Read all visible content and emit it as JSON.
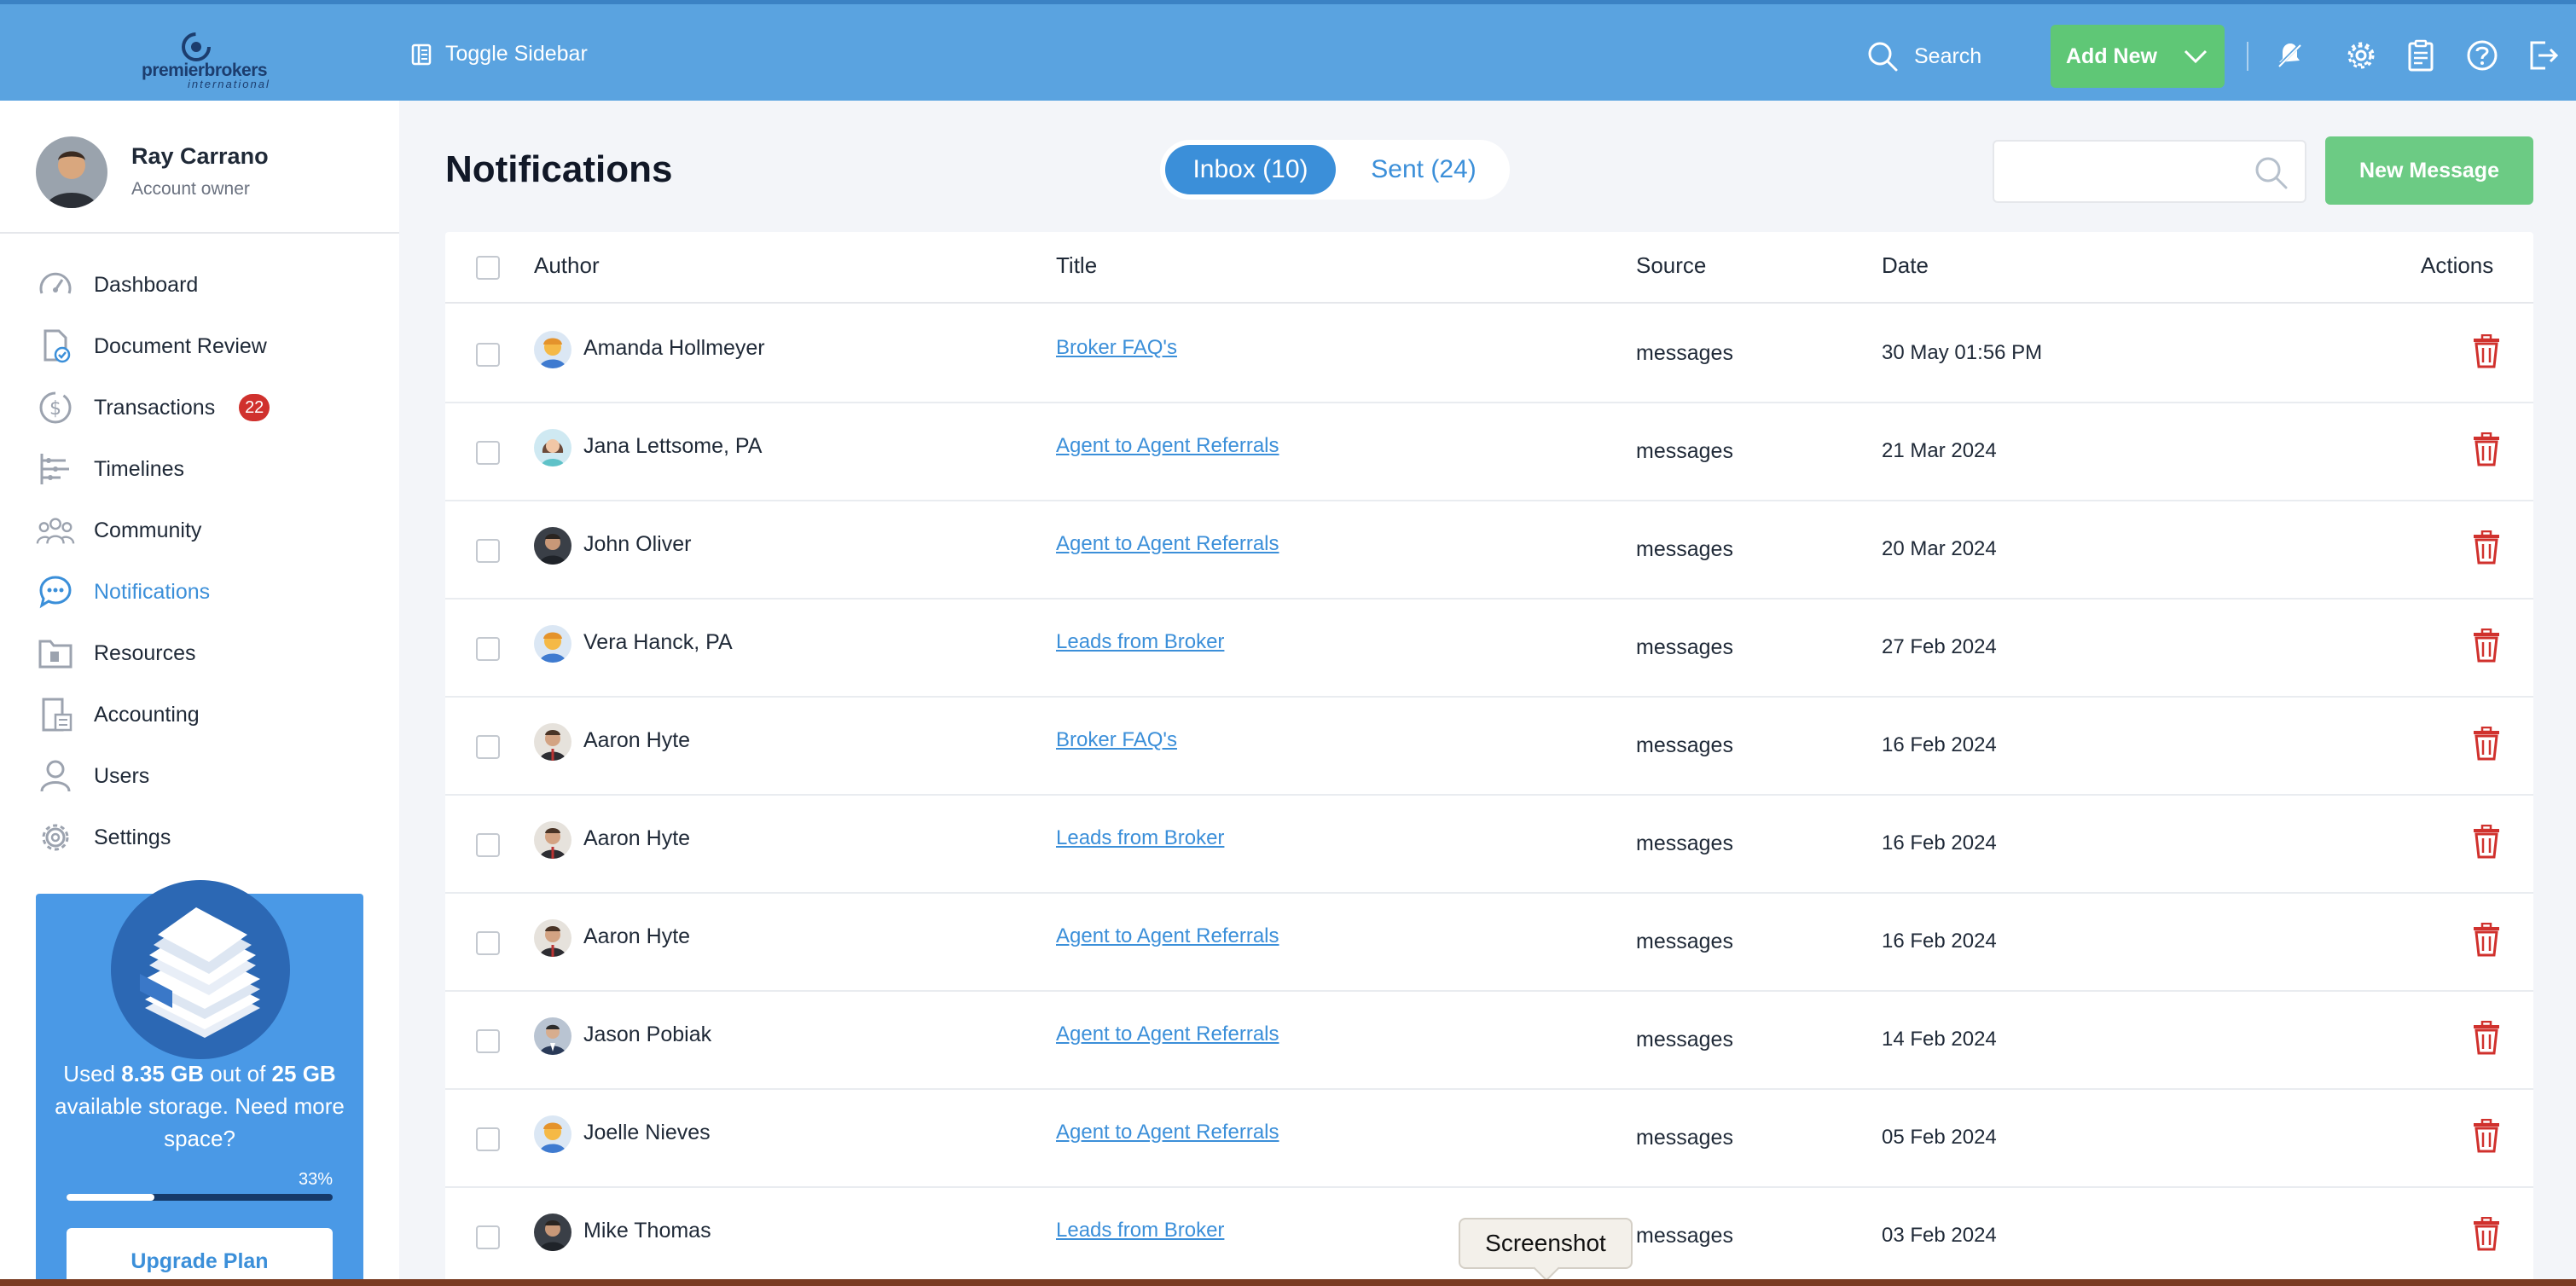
{
  "header": {
    "logo_text_main": "premierbrokers",
    "logo_text_sub": "international",
    "toggle_label": "Toggle Sidebar",
    "search_label": "Search",
    "add_new_label": "Add New",
    "icons": [
      "bell-off-icon",
      "gear-icon",
      "clipboard-icon",
      "help-icon",
      "logout-icon"
    ]
  },
  "user": {
    "name": "Ray Carrano",
    "role": "Account owner"
  },
  "sidebar": {
    "items": [
      {
        "label": "Dashboard",
        "icon": "speedometer-icon",
        "active": false
      },
      {
        "label": "Document Review",
        "icon": "document-check-icon",
        "active": false
      },
      {
        "label": "Transactions",
        "icon": "dollar-circle-icon",
        "badge": "22",
        "active": false
      },
      {
        "label": "Timelines",
        "icon": "timeline-icon",
        "active": false
      },
      {
        "label": "Community",
        "icon": "community-icon",
        "active": false
      },
      {
        "label": "Notifications",
        "icon": "chat-bubble-icon",
        "active": true
      },
      {
        "label": "Resources",
        "icon": "folder-icon",
        "active": false
      },
      {
        "label": "Accounting",
        "icon": "calculator-icon",
        "active": false
      },
      {
        "label": "Users",
        "icon": "user-icon",
        "active": false
      },
      {
        "label": "Settings",
        "icon": "gear-icon",
        "active": false
      }
    ]
  },
  "storage": {
    "used_prefix": "Used ",
    "used": "8.35 GB",
    "mid": " out of ",
    "total": "25 GB",
    "suffix": " available storage. Need more space?",
    "percent_label": "33%",
    "percent": 33,
    "upgrade_label": "Upgrade Plan"
  },
  "main": {
    "title": "Notifications",
    "tab_inbox": "Inbox (10)",
    "tab_sent": "Sent (24)",
    "search_placeholder": "",
    "new_message_label": "New Message"
  },
  "table": {
    "columns": {
      "author": "Author",
      "title": "Title",
      "source": "Source",
      "date": "Date",
      "actions": "Actions"
    },
    "rows": [
      {
        "author": "Amanda Hollmeyer",
        "title": "Broker FAQ's",
        "source": "messages",
        "date": "30 May 01:56 PM",
        "avatar": "cartoon"
      },
      {
        "author": "Jana Lettsome, PA",
        "title": "Agent to Agent Referrals",
        "source": "messages",
        "date": "21 Mar 2024",
        "avatar": "woman"
      },
      {
        "author": "John Oliver",
        "title": "Agent to Agent Referrals",
        "source": "messages",
        "date": "20 Mar 2024",
        "avatar": "dark"
      },
      {
        "author": "Vera Hanck, PA",
        "title": "Leads from Broker",
        "source": "messages",
        "date": "27 Feb 2024",
        "avatar": "cartoon"
      },
      {
        "author": "Aaron Hyte",
        "title": "Broker FAQ's",
        "source": "messages",
        "date": "16 Feb 2024",
        "avatar": "photo"
      },
      {
        "author": "Aaron Hyte",
        "title": "Leads from Broker",
        "source": "messages",
        "date": "16 Feb 2024",
        "avatar": "photo"
      },
      {
        "author": "Aaron Hyte",
        "title": "Agent to Agent Referrals",
        "source": "messages",
        "date": "16 Feb 2024",
        "avatar": "photo"
      },
      {
        "author": "Jason Pobiak",
        "title": "Agent to Agent Referrals",
        "source": "messages",
        "date": "14 Feb 2024",
        "avatar": "suit"
      },
      {
        "author": "Joelle Nieves",
        "title": "Agent to Agent Referrals",
        "source": "messages",
        "date": "05 Feb 2024",
        "avatar": "cartoon"
      },
      {
        "author": "Mike Thomas",
        "title": "Leads from Broker",
        "source": "messages",
        "date": "03 Feb 2024",
        "avatar": "dark"
      }
    ]
  },
  "tooltip": {
    "label": "Screenshot"
  }
}
